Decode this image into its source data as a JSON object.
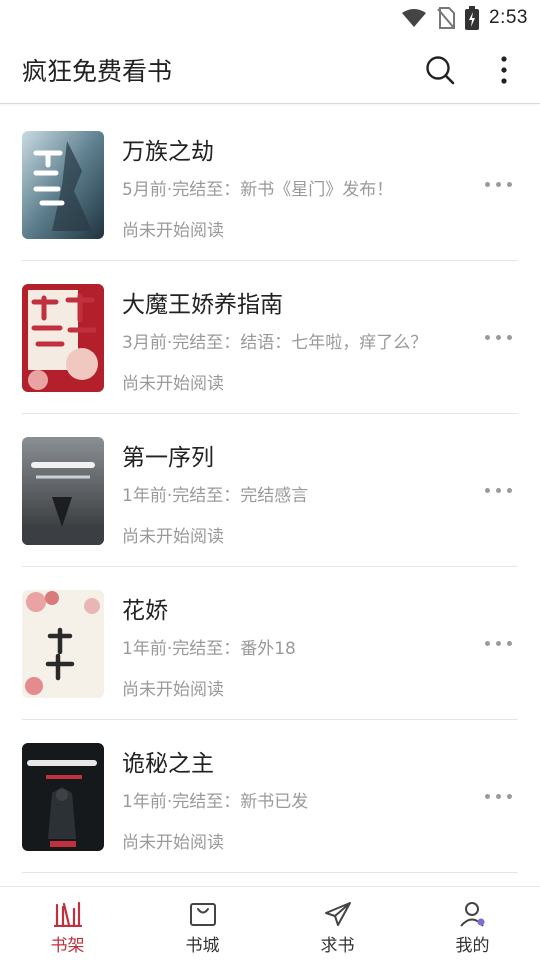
{
  "status": {
    "time": "2:53"
  },
  "app": {
    "title": "疯狂免费看书"
  },
  "books": [
    {
      "title": "万族之劫",
      "update": "5月前·完结至：新书《星门》发布！",
      "progress": "尚未开始阅读"
    },
    {
      "title": "大魔王娇养指南",
      "update": "3月前·完结至：结语：七年啦，痒了么？",
      "progress": "尚未开始阅读"
    },
    {
      "title": "第一序列",
      "update": "1年前·完结至：完结感言",
      "progress": "尚未开始阅读"
    },
    {
      "title": "花娇",
      "update": "1年前·完结至：番外18",
      "progress": "尚未开始阅读"
    },
    {
      "title": "诡秘之主",
      "update": "1年前·完结至：新书已发",
      "progress": "尚未开始阅读"
    }
  ],
  "nav": {
    "items": [
      {
        "label": "书架",
        "icon": "bookshelf-icon"
      },
      {
        "label": "书城",
        "icon": "bookstore-icon"
      },
      {
        "label": "求书",
        "icon": "paper-plane-icon"
      },
      {
        "label": "我的",
        "icon": "profile-icon"
      }
    ]
  },
  "colors": {
    "accent": "#c0303f",
    "text": "#222222",
    "secondary": "#9a9a9a",
    "divider": "#e6e6e6"
  }
}
